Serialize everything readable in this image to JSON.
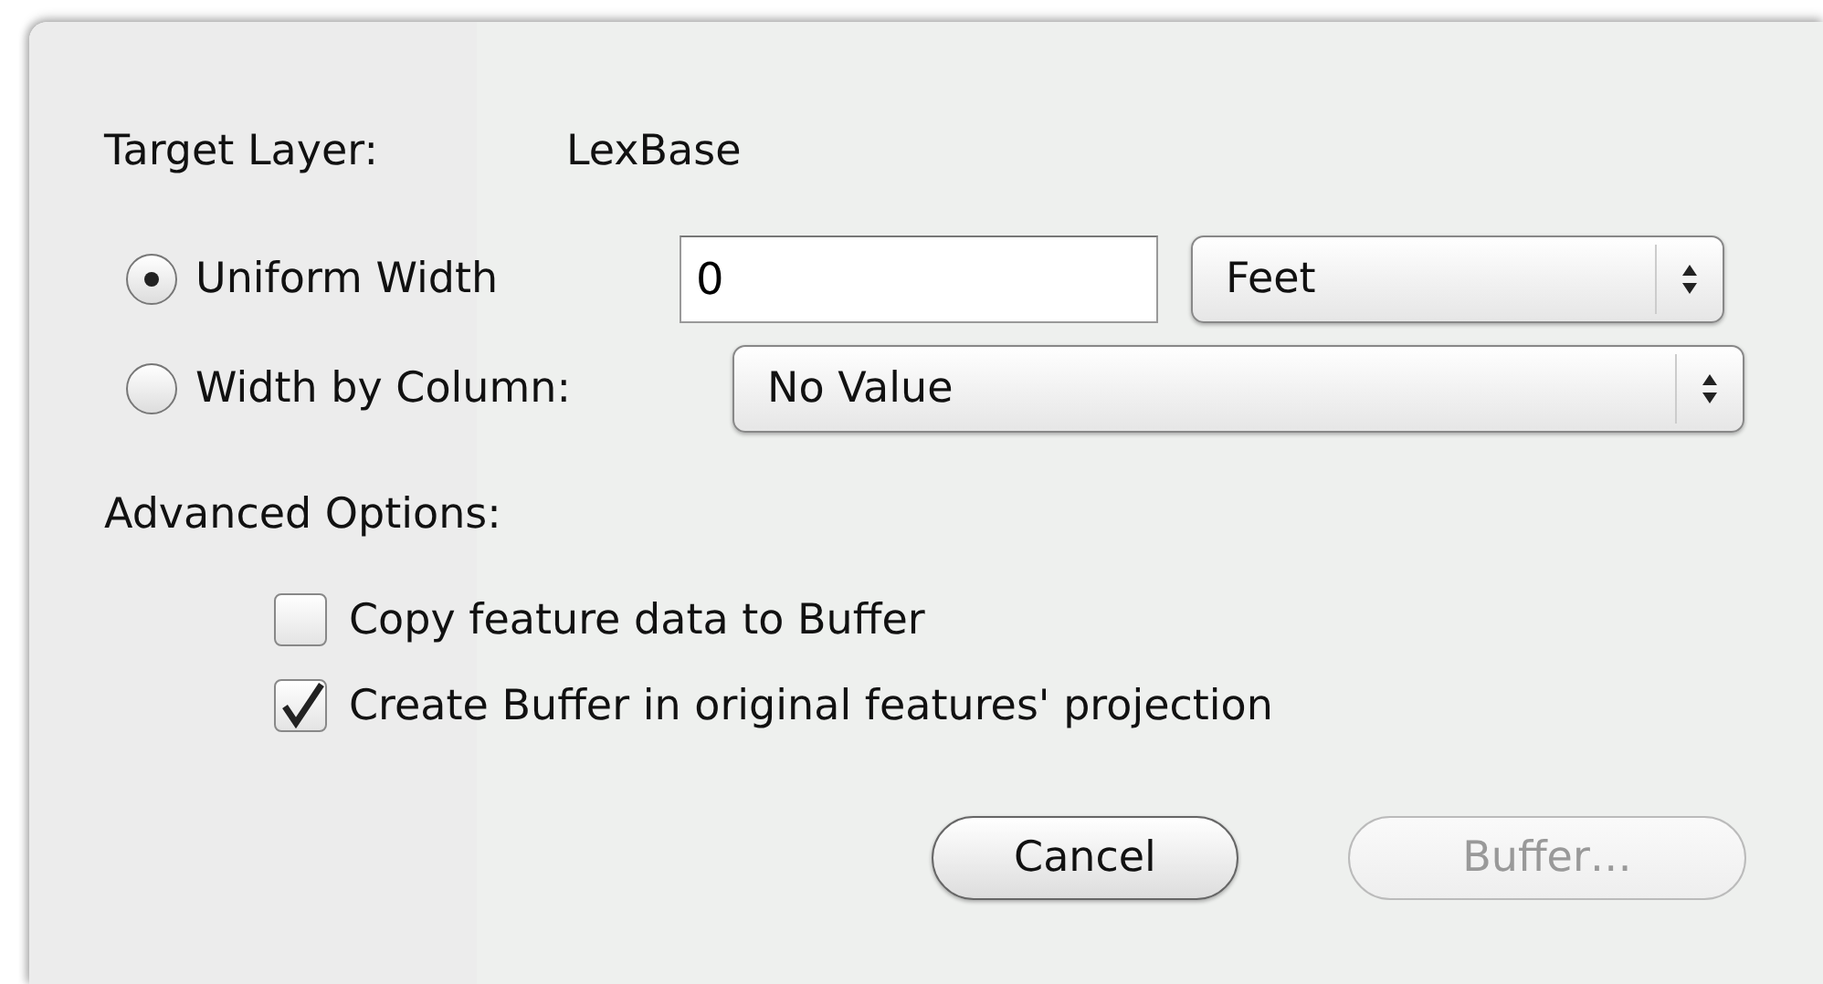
{
  "target_layer": {
    "label": "Target Layer:",
    "value": "LexBase"
  },
  "width_options": [
    {
      "kind": "input",
      "label": "Uniform Width",
      "selected": true,
      "value": "0",
      "units": "Feet"
    },
    {
      "kind": "popup",
      "label": "Width by Column:",
      "selected": false,
      "popup": "No Value"
    }
  ],
  "advanced_options": {
    "label": "Advanced Options:",
    "checkboxes": [
      {
        "label": "Copy feature data to Buffer",
        "checked": false
      },
      {
        "label": "Create Buffer in original features' projection",
        "checked": true
      }
    ]
  },
  "buttons": [
    {
      "label": "Cancel",
      "disabled": false
    },
    {
      "label": "Buffer…",
      "disabled": true
    }
  ]
}
